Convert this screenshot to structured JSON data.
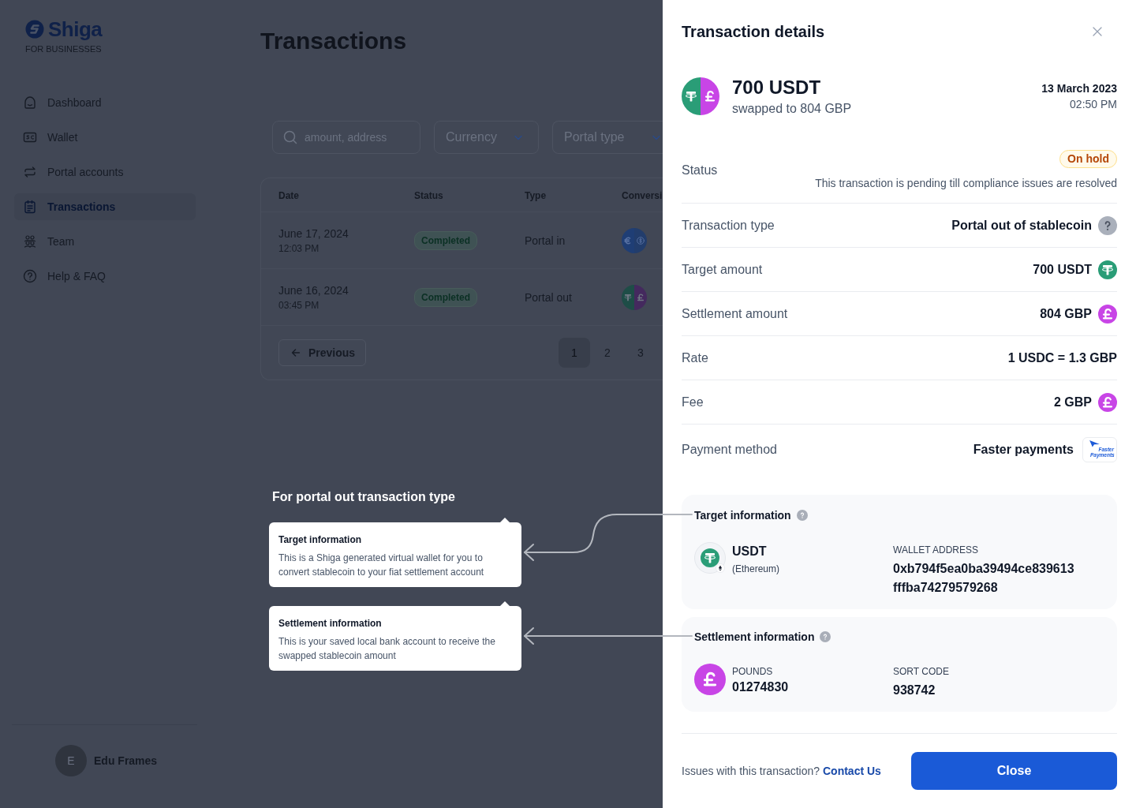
{
  "sidebar": {
    "logo": {
      "name": "Shiga",
      "tagline": "FOR BUSINESSES"
    },
    "items": [
      {
        "label": "Dashboard",
        "selected": false
      },
      {
        "label": "Wallet",
        "selected": false
      },
      {
        "label": "Portal accounts",
        "selected": false
      },
      {
        "label": "Transactions",
        "selected": true
      },
      {
        "label": "Team",
        "selected": false
      },
      {
        "label": "Help & FAQ",
        "selected": false
      }
    ],
    "user": {
      "initial": "E",
      "name": "Edu Frames"
    }
  },
  "page": {
    "title": "Transactions",
    "search": {
      "placeholder": "amount, address"
    },
    "filters": [
      {
        "label": "Currency"
      },
      {
        "label": "Portal type"
      }
    ]
  },
  "table": {
    "columns": [
      "Date",
      "Status",
      "Type",
      "Conversi"
    ],
    "rows": [
      {
        "date": "June 17, 2024",
        "time": "12:03 PM",
        "status": "Completed",
        "type": "Portal in"
      },
      {
        "date": "June 16, 2024",
        "time": "03:45 PM",
        "status": "Completed",
        "type": "Portal out"
      }
    ],
    "pagination": {
      "previous": "Previous",
      "pages": [
        {
          "label": "1",
          "selected": true
        },
        {
          "label": "2",
          "selected": false
        },
        {
          "label": "3",
          "selected": false
        }
      ]
    }
  },
  "annotations": {
    "heading": "For portal out transaction type",
    "notes": [
      {
        "title": "Target information",
        "text": "This is a Shiga generated virtual wallet for you to convert stablecoin to your fiat settlement account"
      },
      {
        "title": "Settlement information",
        "text": "This is your saved local bank account to receive the swapped stablecoin amount"
      }
    ]
  },
  "drawer": {
    "title": "Transaction details",
    "summary": {
      "amount": "700 USDT",
      "subtitle": "swapped to 804 GBP",
      "date": "13 March 2023",
      "time": "02:50 PM"
    },
    "status": {
      "label": "Status",
      "badge": "On hold",
      "note": "This transaction is pending till compliance issues are resolved"
    },
    "details": [
      {
        "label": "Transaction type",
        "value": "Portal out of stablecoin",
        "kind": "help"
      },
      {
        "label": "Target amount",
        "value": "700 USDT",
        "kind": "tether"
      },
      {
        "label": "Settlement amount",
        "value": "804 GBP",
        "kind": "pound"
      },
      {
        "label": "Rate",
        "value": "1 USDC = 1.3 GBP",
        "kind": "plain"
      },
      {
        "label": "Fee",
        "value": "2 GBP",
        "kind": "pound"
      },
      {
        "label": "Payment method",
        "value": "Faster payments",
        "kind": "faster",
        "logo_text": "Faster Payments"
      }
    ],
    "target": {
      "title": "Target information",
      "coin": "USDT",
      "network": "(Ethereum)",
      "address_label": "WALLET ADDRESS",
      "address": "0xb794f5ea0ba39494ce839613fffba74279579268"
    },
    "settlement": {
      "title": "Settlement information",
      "account_label": "POUNDS",
      "account": "01274830",
      "sort_label": "SORT CODE",
      "sort_code": "938742"
    },
    "footer": {
      "question": "Issues with this transaction?",
      "link": "Contact Us",
      "button": "Close"
    }
  }
}
